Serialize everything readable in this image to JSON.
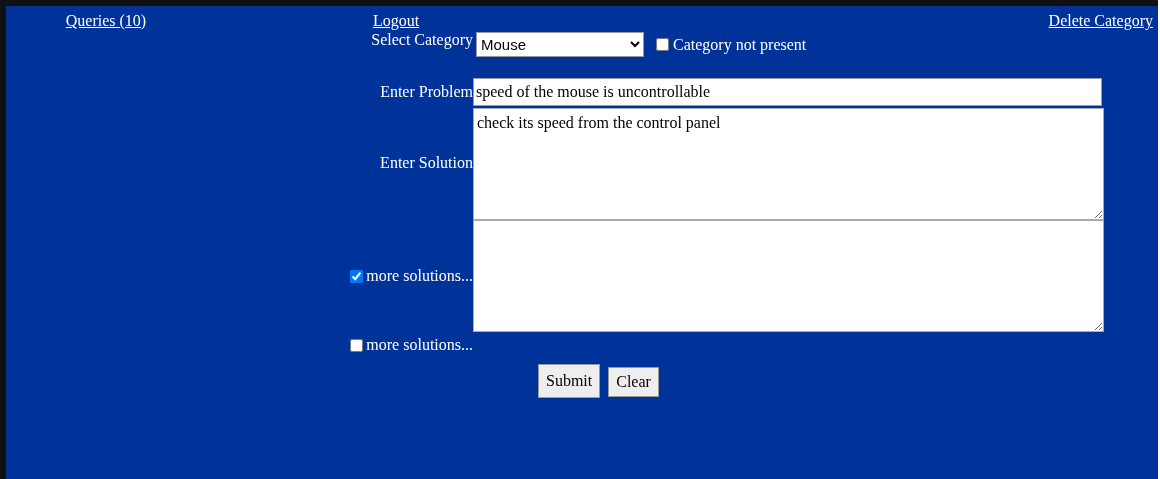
{
  "nav": [
    {
      "label": "Queries (10)"
    },
    {
      "label": "Logout"
    },
    {
      "label": "Delete Category"
    }
  ],
  "category": {
    "label": "Select Category",
    "value": "Mouse",
    "not_present": {
      "label": "Category not present",
      "checked": false
    }
  },
  "problem": {
    "label": "Enter Problem",
    "value": "speed of the mouse is uncontrollable"
  },
  "solution": {
    "label": "Enter Solution",
    "value": "check its speed from the control panel"
  },
  "more_solutions": [
    {
      "label": "more solutions...",
      "checked": true
    },
    {
      "label": "more solutions...",
      "checked": false
    }
  ],
  "buttons": [
    "Submit",
    "Clear"
  ]
}
